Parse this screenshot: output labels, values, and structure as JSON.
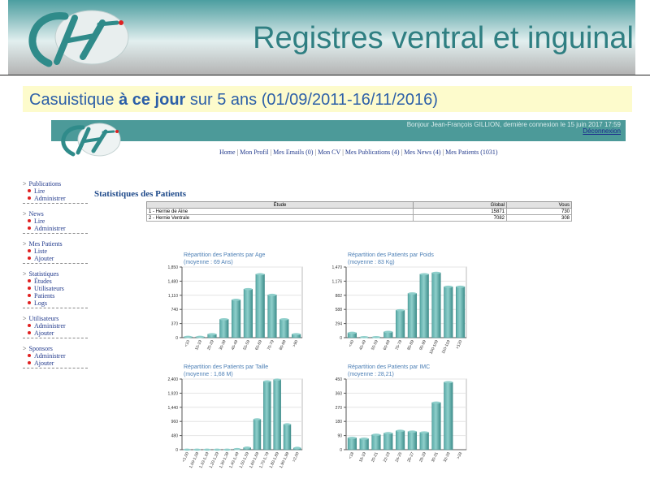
{
  "slide": {
    "title": "Registres ventral et inguinal",
    "caption_pre": "Casuistique ",
    "caption_bold": "à ce jour",
    "caption_post": " sur 5 ans (01/09/2011-16/11/2016)"
  },
  "app": {
    "greeting": "Bonjour Jean-François GILLION, dernière connexion le 15 juin 2017 17:59",
    "logout": "Déconnexion",
    "nav": [
      "Home",
      "Mon Profil",
      "Mes Emails (0)",
      "Mon CV",
      "Mes Publications (4)",
      "Mes News (4)",
      "Mes Patients (1031)"
    ]
  },
  "sidebar": [
    {
      "title": "Publications",
      "items": [
        "Lire",
        "Administrer"
      ]
    },
    {
      "title": "News",
      "items": [
        "Lire",
        "Administrer"
      ]
    },
    {
      "title": "Mes Patients",
      "items": [
        "Liste",
        "Ajouter"
      ]
    },
    {
      "title": "Statistiques",
      "items": [
        "Études",
        "Utilisateurs",
        "Patients",
        "Logs"
      ]
    },
    {
      "title": "Utilisateurs",
      "items": [
        "Administrer",
        "Ajouter"
      ]
    },
    {
      "title": "Sponsors",
      "items": [
        "Administrer",
        "Ajouter"
      ]
    }
  ],
  "main": {
    "heading": "Statistiques des Patients",
    "table": {
      "columns": [
        "Étude",
        "Global",
        "Vous"
      ],
      "rows": [
        [
          "1 - Hernie de Aine",
          "15871",
          "730"
        ],
        [
          "2 - Hernie Ventrale",
          "7082",
          "308"
        ]
      ]
    }
  },
  "colors": {
    "bar": "#5aaba8",
    "bar_top": "#8fcfcb",
    "banner": "#4c9a99",
    "title": "#2f7f82",
    "caption": "#2c5fa8"
  },
  "chart_data": [
    {
      "type": "bar",
      "title": "Répartition des Patients par Age",
      "subtitle": "(moyenne : 69 Ans)",
      "categories": [
        "<10",
        "10-19",
        "20-29",
        "30-39",
        "40-49",
        "50-59",
        "60-69",
        "70-79",
        "80-89",
        ">90"
      ],
      "values": [
        20,
        20,
        90,
        480,
        990,
        1270,
        1660,
        1120,
        480,
        90
      ],
      "ylim": [
        0,
        1850
      ],
      "yticks": [
        "0",
        "370",
        "740",
        "1,110",
        "1,480",
        "1,850"
      ]
    },
    {
      "type": "bar",
      "title": "Répartition des Patients par Poids",
      "subtitle": "(moyenne : 83 Kg)",
      "categories": [
        "<40",
        "40-49",
        "50-59",
        "60-69",
        "70-79",
        "80-89",
        "90-99",
        "100-109",
        "110-119",
        ">120"
      ],
      "values": [
        100,
        10,
        10,
        120,
        570,
        920,
        1320,
        1350,
        1060,
        1060
      ],
      "ylim": [
        0,
        1470
      ],
      "yticks": [
        "0",
        "294",
        "588",
        "882",
        "1,176",
        "1,470"
      ]
    },
    {
      "type": "bar",
      "title": "Répartition des Patients par Taille",
      "subtitle": "(moyenne : 1,68 M)",
      "categories": [
        "<1,00",
        "1,00-1,09",
        "1,10-1,19",
        "1,20-1,29",
        "1,30-1,39",
        "1,40-1,49",
        "1,50-1,59",
        "1,60-1,69",
        "1,70-1,79",
        "1,80-1,89",
        "1,90-1,99",
        ">2,00"
      ],
      "values": [
        0,
        0,
        0,
        0,
        0,
        20,
        70,
        1030,
        2320,
        2380,
        860,
        60
      ],
      "ylim": [
        0,
        2400
      ],
      "yticks": [
        "0",
        "480",
        "960",
        "1,440",
        "1,920",
        "2,400"
      ]
    },
    {
      "type": "bar",
      "title": "Répartition des Patients par IMC",
      "subtitle": "(moyenne : 28,21)",
      "categories": [
        "<18",
        "18-19",
        "20-21",
        "22-23",
        "24-25",
        "26-27",
        "28-29",
        "30-31",
        "32-33",
        ">33"
      ],
      "values": [
        75,
        70,
        95,
        105,
        120,
        115,
        110,
        300,
        430
      ],
      "ylim": [
        0,
        450
      ],
      "yticks": [
        "0",
        "90",
        "180",
        "270",
        "360",
        "450"
      ]
    }
  ]
}
